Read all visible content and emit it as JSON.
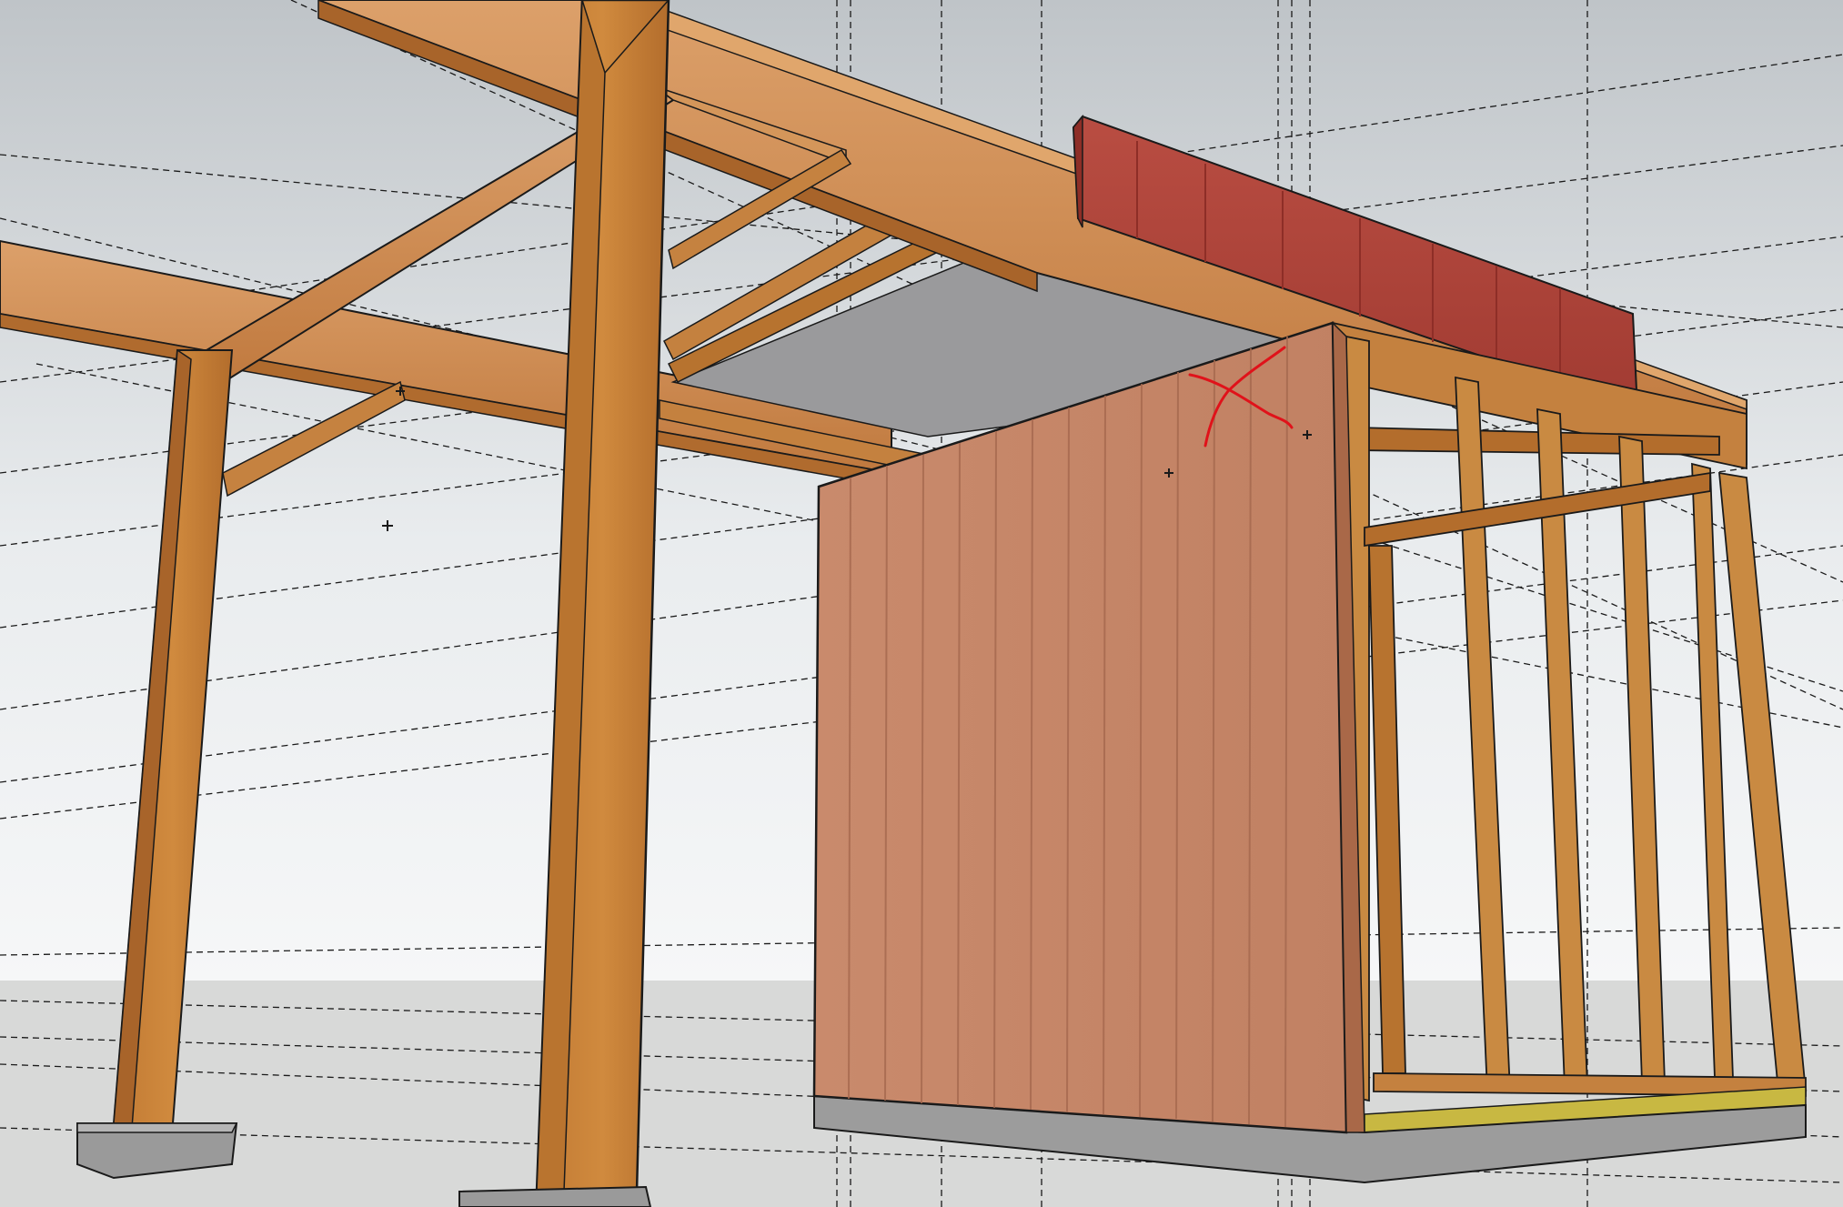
{
  "app": {
    "view": "3d-model-viewport"
  },
  "scene": {
    "sky_top": "#bfc4c8",
    "sky_bottom": "#f4f6f7",
    "ground": "#d6d7d6",
    "wood_light": "#d79a5a",
    "wood_dark": "#b4702f",
    "wood_face": "#c98546",
    "plank_wall": "#c98a6c",
    "plank_wall_shade": "#b8765a",
    "red_panel": "#b1463b",
    "red_panel_edge": "#8e2e27",
    "ceiling_gray": "#9a9a9c",
    "concrete": "#9c9c9c",
    "sill_yellow": "#c8b842",
    "annotation_red": "#e0121a",
    "guide_color": "#1a1a1a"
  },
  "annotation": {
    "mark": "red-x",
    "icon": "x-mark-icon"
  }
}
